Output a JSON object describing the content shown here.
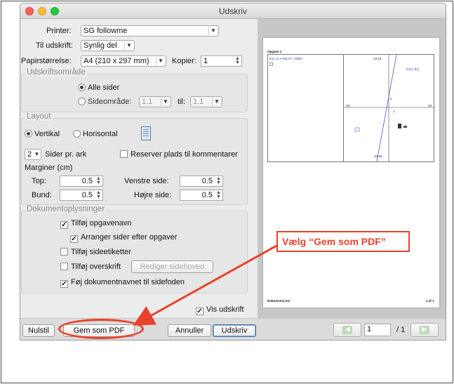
{
  "window": {
    "title": "Udskriv"
  },
  "printer": {
    "label": "Printer:",
    "value": "SG followme"
  },
  "print_to": {
    "label": "Til udskrift:",
    "value": "Synlig del"
  },
  "paper": {
    "label": "Papirstørrelse:",
    "value": "A4 (210 x 297 mm)",
    "copies_label": "Kopier:",
    "copies_value": "1"
  },
  "print_area": {
    "title": "Udskriftsområde",
    "all_pages": "Alle sider",
    "page_range": "Sideområde:",
    "from": "1.1",
    "to_label": "til:",
    "to": "1.1"
  },
  "layout": {
    "title": "Layout",
    "portrait": "Vertikal",
    "landscape": "Horisontal",
    "pages_per_sheet_value": "2",
    "pages_per_sheet_label": "Sider pr. ark",
    "reserve_comments": "Reserver plads til kommentarer",
    "margins_label": "Marginer (cm)",
    "top_label": "Top:",
    "top_value": "0.5",
    "left_label": "Venstre side:",
    "left_value": "0.5",
    "bottom_label": "Bund:",
    "bottom_value": "0.5",
    "right_label": "Højre side:",
    "right_value": "0.5"
  },
  "docinfo": {
    "title": "Dokumentoplysninger",
    "add_task_name": "Tilføj opgavenavn",
    "arrange_pages": "Arranger sider efter opgaver",
    "add_page_labels": "Tilføj sideetiketter",
    "add_header": "Tilføj overskrift",
    "edit_header": "Rediger sidehoved",
    "add_doc_name": "Føj dokumentnavnet til sidefoden"
  },
  "show_preview": "Vis udskrift",
  "buttons": {
    "reset": "Nulstil",
    "save_pdf": "Gem som PDF",
    "cancel": "Annuller",
    "print": "Udskriv"
  },
  "preview": {
    "page_title": "Opgave 1",
    "function_text": "f(x):=a·x+b|a>0 • Udført",
    "graph_label": "f1(x)=f(x)",
    "y_max": "13.44",
    "y_min": "-13.44",
    "x_min": "-10",
    "x_max": "10",
    "tick_one_y": "1",
    "tick_one_x": "1",
    "footer_left": "Dokument1.tns",
    "footer_right": "1 af 1"
  },
  "pager": {
    "current": "1",
    "total": "/ 1"
  },
  "annotation": {
    "text": "Vælg “Gem som PDF”",
    "color": "#e8412c"
  }
}
